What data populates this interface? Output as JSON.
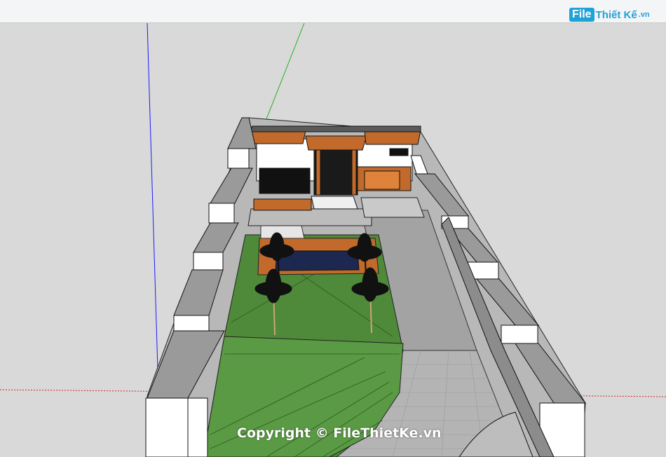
{
  "app": {
    "name": "SketchUp-style 3D model viewport"
  },
  "watermark": {
    "logo_box": "File",
    "logo_text": "Thiết Kế",
    "logo_suffix": ".vn",
    "copyright": "Copyright © FileThietKe.vn"
  },
  "colors": {
    "viewport_bg": "#d9d9d9",
    "grass": "#4e8a3a",
    "paving": "#a9a9a9",
    "wall_top": "#9a9a9a",
    "wall_face": "#ffffff",
    "wood": "#c26a2b",
    "axis_blue": "#1a1aff",
    "axis_green": "#22b322",
    "axis_red": "#cc2222"
  },
  "icons": {
    "logo": "filethietke-logo-icon"
  }
}
